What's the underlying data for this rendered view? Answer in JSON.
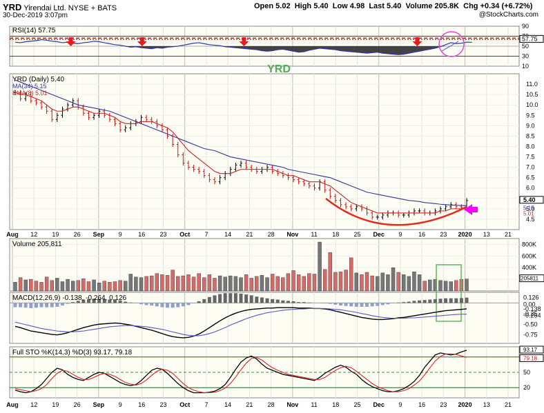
{
  "header": {
    "symbol": "YRD",
    "company": "Yirendai Ltd.",
    "exchange": "NYSE + BATS",
    "date": "30-Dec-2019 3:07pm",
    "open": "Open 5.02",
    "high": "High 5.40",
    "low": "Low 4.98",
    "last": "Last 5.40",
    "volume": "Volume 205.8K",
    "change": "Chg +0.34 (+6.72%)",
    "credit": "@StockCharts.com"
  },
  "annotation": {
    "watermark": "YRD",
    "arrow_color": "#ff00ff",
    "marker_color": "#e02020"
  },
  "colors": {
    "up": "#000000",
    "down": "#cc1111",
    "ma34": "#333399",
    "ema8": "#cc2222",
    "rsi": "#3333aa",
    "panel_bg": "#fdfdf4"
  },
  "chart_data": [
    {
      "type": "line",
      "panel": "rsi",
      "title": "RSI(14) 57.75",
      "ylim": [
        10,
        90
      ],
      "yticks": [
        10,
        30,
        50,
        70,
        90
      ],
      "reference_lines": [
        30,
        50,
        70
      ],
      "last_value": 57.75,
      "last_label": "57.75",
      "series": [
        {
          "values": [
            58,
            57,
            59,
            60,
            61,
            63,
            62,
            60,
            59,
            57,
            58,
            56,
            55,
            57,
            58,
            60,
            59,
            57,
            55,
            53,
            52,
            50,
            48,
            49,
            47,
            46,
            45,
            47,
            46,
            48,
            49,
            50,
            52,
            54,
            56,
            57,
            55,
            53,
            52,
            51,
            49,
            48,
            47,
            46,
            45,
            44,
            43,
            41,
            40,
            41,
            43,
            44,
            42,
            40,
            38,
            39,
            42,
            44,
            46,
            45,
            44,
            43,
            41,
            40,
            39,
            38,
            37,
            36,
            37,
            38,
            36,
            35,
            34,
            33,
            34,
            36,
            38,
            40,
            42,
            44,
            46,
            49,
            53,
            57,
            55,
            56,
            58,
            57.75
          ]
        }
      ]
    },
    {
      "type": "candlestick",
      "panel": "price",
      "title": "YRD (Daily) 5.40",
      "legend": [
        "MA(34) 5.15",
        "EMA(8) 5.01"
      ],
      "ylim": [
        4.0,
        11.5
      ],
      "yticks": [
        4.5,
        5.0,
        5.5,
        6.0,
        6.5,
        7.0,
        7.5,
        8.0,
        8.5,
        9.0,
        9.5,
        10.0,
        10.5,
        11.0
      ],
      "last_label": "5.40",
      "ma_label": "5.15",
      "ema_label": "5.01",
      "x_labels": [
        "Aug",
        "12",
        "19",
        "26",
        "Sep",
        "9",
        "16",
        "23",
        "Oct",
        "7",
        "14",
        "21",
        "28",
        "Nov",
        "11",
        "18",
        "25",
        "Dec",
        "9",
        "16",
        "23",
        "2020",
        "13",
        "21"
      ],
      "close": [
        10.6,
        10.3,
        10.5,
        10.2,
        10.1,
        9.9,
        9.7,
        9.3,
        9.5,
        9.8,
        10.0,
        10.2,
        9.9,
        9.6,
        9.4,
        9.5,
        9.7,
        9.5,
        9.3,
        9.1,
        8.8,
        8.9,
        9.1,
        9.2,
        9.4,
        9.3,
        9.2,
        9.0,
        8.8,
        8.5,
        8.1,
        7.6,
        7.2,
        7.0,
        6.9,
        6.8,
        6.6,
        6.4,
        6.3,
        6.5,
        6.7,
        6.9,
        7.1,
        7.2,
        7.0,
        6.9,
        6.8,
        6.9,
        7.0,
        6.8,
        6.7,
        6.6,
        6.5,
        6.4,
        6.3,
        6.2,
        6.1,
        6.0,
        6.3,
        5.9,
        5.6,
        5.4,
        5.2,
        5.1,
        5.0,
        5.1,
        5.0,
        4.8,
        4.6,
        4.6,
        4.7,
        4.8,
        4.8,
        4.7,
        4.7,
        4.8,
        4.9,
        4.9,
        4.8,
        4.8,
        4.9,
        5.0,
        5.1,
        5.2,
        5.1,
        5.06,
        5.4
      ],
      "ma34": [
        11.2,
        11.1,
        11.0,
        10.9,
        10.8,
        10.7,
        10.6,
        10.5,
        10.4,
        10.3,
        10.2,
        10.1,
        10.0,
        9.95,
        9.9,
        9.85,
        9.8,
        9.75,
        9.7,
        9.6,
        9.5,
        9.4,
        9.3,
        9.2,
        9.1,
        9.0,
        8.9,
        8.8,
        8.7,
        8.6,
        8.5,
        8.4,
        8.3,
        8.2,
        8.1,
        8.0,
        7.9,
        7.85,
        7.8,
        7.7,
        7.6,
        7.5,
        7.45,
        7.4,
        7.35,
        7.3,
        7.25,
        7.2,
        7.15,
        7.1,
        7.05,
        7.0,
        6.9,
        6.85,
        6.8,
        6.75,
        6.7,
        6.65,
        6.6,
        6.55,
        6.5,
        6.4,
        6.3,
        6.2,
        6.1,
        6.0,
        5.9,
        5.8,
        5.75,
        5.7,
        5.65,
        5.6,
        5.55,
        5.5,
        5.45,
        5.4,
        5.38,
        5.35,
        5.3,
        5.28,
        5.25,
        5.22,
        5.2,
        5.18,
        5.17,
        5.16,
        5.15
      ],
      "ema8": [
        10.6,
        10.5,
        10.5,
        10.4,
        10.3,
        10.2,
        10.0,
        9.8,
        9.7,
        9.7,
        9.8,
        9.9,
        9.9,
        9.8,
        9.7,
        9.6,
        9.6,
        9.6,
        9.5,
        9.4,
        9.2,
        9.1,
        9.1,
        9.1,
        9.2,
        9.2,
        9.2,
        9.1,
        9.0,
        8.9,
        8.7,
        8.4,
        8.1,
        7.8,
        7.6,
        7.4,
        7.2,
        7.0,
        6.8,
        6.7,
        6.7,
        6.7,
        6.8,
        6.9,
        6.9,
        6.9,
        6.9,
        6.9,
        6.9,
        6.9,
        6.8,
        6.7,
        6.6,
        6.6,
        6.5,
        6.4,
        6.3,
        6.3,
        6.3,
        6.2,
        6.1,
        5.9,
        5.7,
        5.5,
        5.3,
        5.2,
        5.1,
        5.0,
        4.9,
        4.8,
        4.8,
        4.8,
        4.8,
        4.8,
        4.8,
        4.8,
        4.8,
        4.8,
        4.8,
        4.8,
        4.8,
        4.9,
        4.9,
        5.0,
        5.0,
        5.0,
        5.01
      ]
    },
    {
      "type": "bar",
      "panel": "volume",
      "title": "Volume 205,811",
      "ylim": [
        0,
        900000
      ],
      "ytick_labels": [
        "200K",
        "400K",
        "600K",
        "800K"
      ],
      "yticks": [
        200000,
        400000,
        600000,
        800000
      ],
      "last_label": "205811",
      "values": [
        150000,
        230000,
        190000,
        200000,
        170000,
        150000,
        240000,
        180000,
        220000,
        160000,
        200000,
        170000,
        180000,
        210000,
        160000,
        190000,
        140000,
        170000,
        150000,
        160000,
        180000,
        170000,
        290000,
        240000,
        230000,
        250000,
        260000,
        300000,
        280000,
        270000,
        360000,
        250000,
        260000,
        280000,
        240000,
        300000,
        230000,
        280000,
        220000,
        260000,
        240000,
        260000,
        250000,
        230000,
        280000,
        220000,
        250000,
        270000,
        230000,
        290000,
        250000,
        230000,
        300000,
        350000,
        280000,
        250000,
        300000,
        290000,
        840000,
        370000,
        660000,
        320000,
        330000,
        360000,
        570000,
        310000,
        280000,
        320000,
        260000,
        250000,
        310000,
        280000,
        400000,
        320000,
        280000,
        250000,
        330000,
        280000,
        170000,
        190000,
        200000,
        180000,
        170000,
        160000,
        180000,
        200000,
        205811
      ]
    },
    {
      "type": "line",
      "panel": "macd",
      "title": "MACD(12,26,9) -0.138, -0.264, 0.126",
      "ylim": [
        -0.95,
        0.25
      ],
      "yticks": [
        0.126,
        0.0,
        -0.138,
        -0.264,
        -0.25,
        -0.5,
        -0.75
      ],
      "ytick_labels": [
        "0.126",
        "0.00",
        "-0.138",
        "-0.264",
        "-0.25",
        "-0.50",
        "-0.75"
      ],
      "series": [
        {
          "values": [
            -0.55,
            -0.58,
            -0.62,
            -0.66,
            -0.68,
            -0.7,
            -0.72,
            -0.74,
            -0.75,
            -0.73,
            -0.7,
            -0.66,
            -0.62,
            -0.58,
            -0.55,
            -0.52,
            -0.5,
            -0.49,
            -0.48,
            -0.47,
            -0.48,
            -0.5,
            -0.52,
            -0.55,
            -0.58,
            -0.61,
            -0.64,
            -0.68,
            -0.72,
            -0.76,
            -0.79,
            -0.81,
            -0.82,
            -0.81,
            -0.78,
            -0.73,
            -0.66,
            -0.58,
            -0.5,
            -0.42,
            -0.35,
            -0.29,
            -0.24,
            -0.2,
            -0.17,
            -0.15,
            -0.14,
            -0.13,
            -0.12,
            -0.12,
            -0.11,
            -0.11,
            -0.11,
            -0.11,
            -0.12,
            -0.12,
            -0.12,
            -0.13,
            -0.13,
            -0.14,
            -0.16,
            -0.19,
            -0.22,
            -0.25,
            -0.28,
            -0.31,
            -0.34,
            -0.36,
            -0.38,
            -0.39,
            -0.39,
            -0.38,
            -0.37,
            -0.35,
            -0.34,
            -0.32,
            -0.3,
            -0.28,
            -0.26,
            -0.24,
            -0.22,
            -0.2,
            -0.18,
            -0.17,
            -0.16,
            -0.15,
            -0.138
          ]
        },
        {
          "values": [
            -0.45,
            -0.48,
            -0.51,
            -0.54,
            -0.57,
            -0.6,
            -0.62,
            -0.64,
            -0.66,
            -0.67,
            -0.68,
            -0.68,
            -0.67,
            -0.66,
            -0.64,
            -0.62,
            -0.6,
            -0.58,
            -0.56,
            -0.55,
            -0.54,
            -0.53,
            -0.53,
            -0.54,
            -0.55,
            -0.56,
            -0.58,
            -0.6,
            -0.62,
            -0.65,
            -0.68,
            -0.71,
            -0.74,
            -0.76,
            -0.77,
            -0.77,
            -0.75,
            -0.72,
            -0.68,
            -0.63,
            -0.58,
            -0.52,
            -0.47,
            -0.42,
            -0.37,
            -0.33,
            -0.29,
            -0.26,
            -0.23,
            -0.21,
            -0.19,
            -0.17,
            -0.16,
            -0.15,
            -0.14,
            -0.14,
            -0.13,
            -0.13,
            -0.13,
            -0.13,
            -0.14,
            -0.15,
            -0.16,
            -0.18,
            -0.2,
            -0.22,
            -0.25,
            -0.27,
            -0.3,
            -0.32,
            -0.34,
            -0.35,
            -0.36,
            -0.36,
            -0.36,
            -0.35,
            -0.35,
            -0.34,
            -0.33,
            -0.32,
            -0.31,
            -0.3,
            -0.29,
            -0.28,
            -0.27,
            -0.265,
            -0.264
          ]
        },
        {
          "values": [
            -0.1,
            -0.1,
            -0.11,
            -0.12,
            -0.11,
            -0.1,
            -0.1,
            -0.1,
            -0.09,
            -0.06,
            -0.02,
            0.02,
            0.05,
            0.08,
            0.09,
            0.1,
            0.1,
            0.09,
            0.08,
            0.08,
            0.06,
            0.03,
            0.01,
            -0.01,
            -0.03,
            -0.05,
            -0.06,
            -0.08,
            -0.1,
            -0.11,
            -0.11,
            -0.1,
            -0.08,
            -0.05,
            -0.01,
            0.04,
            0.09,
            0.14,
            0.18,
            0.21,
            0.23,
            0.23,
            0.23,
            0.22,
            0.2,
            0.18,
            0.15,
            0.13,
            0.11,
            0.09,
            0.08,
            0.06,
            0.05,
            0.04,
            0.02,
            0.02,
            0.01,
            0.0,
            0.0,
            -0.01,
            -0.02,
            -0.04,
            -0.06,
            -0.07,
            -0.08,
            -0.09,
            -0.09,
            -0.09,
            -0.08,
            -0.07,
            -0.05,
            -0.03,
            -0.01,
            0.01,
            0.02,
            0.03,
            0.05,
            0.06,
            0.07,
            0.08,
            0.09,
            0.1,
            0.11,
            0.11,
            0.11,
            0.115,
            0.126
          ]
        }
      ]
    },
    {
      "type": "line",
      "panel": "sto",
      "title": "Full STO %K(14,3) %D(3) 93.17, 79.18",
      "ylim": [
        0,
        100
      ],
      "yticks": [
        20,
        50,
        80
      ],
      "last_labels": [
        "93.17",
        "79.18"
      ],
      "x_labels": [
        "Aug",
        "12",
        "19",
        "26",
        "Sep",
        "9",
        "16",
        "23",
        "Oct",
        "7",
        "14",
        "21",
        "28",
        "Nov",
        "11",
        "18",
        "25",
        "Dec",
        "9",
        "16",
        "23",
        "2020",
        "13",
        "21"
      ],
      "series": [
        {
          "values": [
            15,
            12,
            10,
            12,
            18,
            26,
            38,
            50,
            58,
            55,
            46,
            40,
            36,
            34,
            40,
            46,
            50,
            48,
            42,
            36,
            30,
            26,
            24,
            26,
            34,
            44,
            54,
            58,
            56,
            48,
            38,
            28,
            20,
            14,
            10,
            10,
            10,
            11,
            13,
            18,
            26,
            40,
            56,
            70,
            78,
            82,
            76,
            66,
            58,
            54,
            50,
            46,
            44,
            42,
            40,
            38,
            36,
            34,
            40,
            48,
            54,
            60,
            64,
            60,
            52,
            46,
            36,
            28,
            22,
            18,
            14,
            12,
            12,
            14,
            18,
            24,
            32,
            44,
            60,
            72,
            84,
            88,
            86,
            84,
            86,
            90,
            93.17
          ]
        },
        {
          "values": [
            18,
            16,
            14,
            12,
            14,
            18,
            26,
            38,
            48,
            54,
            52,
            46,
            40,
            36,
            36,
            40,
            45,
            48,
            46,
            42,
            36,
            30,
            27,
            25,
            28,
            35,
            44,
            52,
            56,
            54,
            48,
            38,
            28,
            20,
            15,
            12,
            10,
            10,
            11,
            14,
            19,
            28,
            41,
            55,
            68,
            77,
            79,
            74,
            66,
            59,
            54,
            50,
            46,
            44,
            42,
            40,
            38,
            36,
            36,
            40,
            47,
            54,
            59,
            62,
            59,
            52,
            44,
            36,
            28,
            22,
            18,
            14,
            12,
            12,
            14,
            18,
            25,
            33,
            45,
            59,
            72,
            81,
            86,
            86,
            85,
            82,
            79.18
          ]
        }
      ]
    }
  ]
}
